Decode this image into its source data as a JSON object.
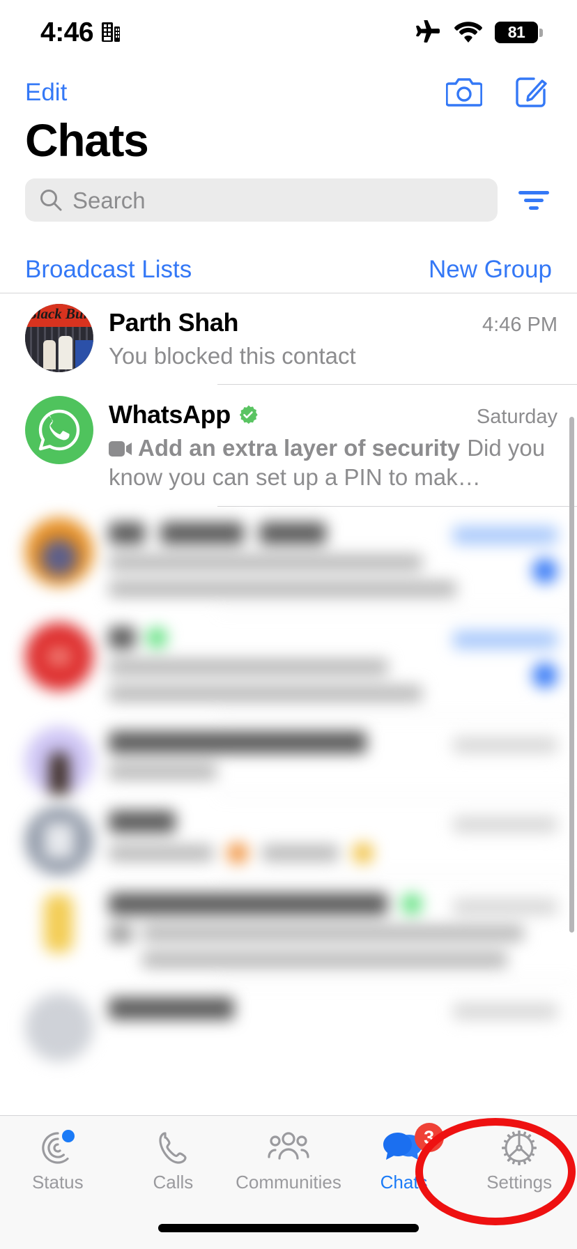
{
  "status_bar": {
    "time": "4:46",
    "screen_record_icon": "screen-record-icon",
    "airplane_icon": "airplane-mode-icon",
    "wifi_icon": "wifi-icon",
    "battery_level": "81"
  },
  "nav": {
    "edit_label": "Edit",
    "camera_icon": "camera-icon",
    "compose_icon": "compose-icon"
  },
  "page_title": "Chats",
  "search": {
    "placeholder": "Search",
    "value": "",
    "search_icon": "search-icon",
    "filter_icon": "filter-icon"
  },
  "quick_links": {
    "broadcast_lists": "Broadcast Lists",
    "new_group": "New Group"
  },
  "chats": [
    {
      "name": "Parth Shah",
      "time": "4:46 PM",
      "preview": "You blocked this contact",
      "avatar_type": "photo",
      "avatar_caption": "Black Bun",
      "verified": false,
      "blurred": false
    },
    {
      "name": "WhatsApp",
      "time": "Saturday",
      "preview_bold": "Add an extra layer of security",
      "preview_rest": "Did you know you can set up a PIN to mak…",
      "preview_icon": "video-camera-icon",
      "avatar_type": "whatsapp-logo",
      "verified": true,
      "blurred": false
    },
    {
      "avatar_type": "orange",
      "blurred": true,
      "unread": true,
      "time_style": "blue",
      "lines": 2
    },
    {
      "avatar_type": "red",
      "blurred": true,
      "unread": true,
      "time_style": "blue",
      "lines": 2
    },
    {
      "avatar_type": "purple",
      "blurred": true,
      "unread": false,
      "time_style": "gray",
      "lines": 1
    },
    {
      "avatar_type": "gray",
      "blurred": true,
      "unread": false,
      "time_style": "gray",
      "lines": 1
    },
    {
      "avatar_type": "yellow",
      "blurred": true,
      "unread": false,
      "time_style": "gray",
      "lines": 2
    }
  ],
  "tabs": [
    {
      "label": "Status",
      "icon": "status-rings-icon",
      "active": false,
      "dot": true,
      "badge": ""
    },
    {
      "label": "Calls",
      "icon": "phone-icon",
      "active": false,
      "dot": false,
      "badge": ""
    },
    {
      "label": "Communities",
      "icon": "communities-icon",
      "active": false,
      "dot": false,
      "badge": ""
    },
    {
      "label": "Chats",
      "icon": "chats-bubbles-icon",
      "active": true,
      "dot": false,
      "badge": "3"
    },
    {
      "label": "Settings",
      "icon": "gear-icon",
      "active": false,
      "dot": false,
      "badge": ""
    }
  ],
  "annotation": {
    "type": "highlight-circle",
    "target": "Settings",
    "color": "#ee1111"
  },
  "colors": {
    "accent_blue": "#3478f6",
    "tab_active_blue": "#1b7bf7",
    "whatsapp_green": "#4fc35d",
    "verified_green": "#5ac462",
    "badge_red": "#ef4136",
    "annotation_red": "#ee1111",
    "secondary_text": "#8c8c8e",
    "search_bg": "#ebebeb",
    "tabbar_bg": "#f8f8f8"
  }
}
